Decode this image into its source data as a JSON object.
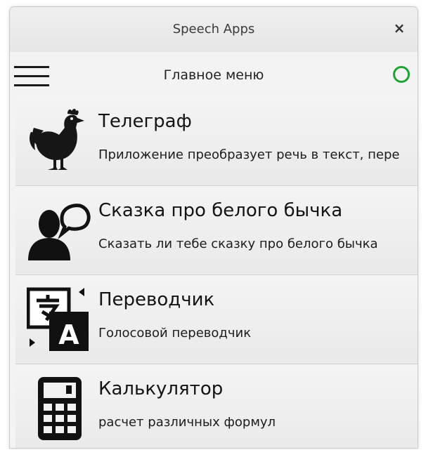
{
  "window": {
    "title": "Speech Apps",
    "close_label": "×"
  },
  "toolbar": {
    "title": "Главное меню",
    "menu_icon": "hamburger-menu-icon",
    "status_icon": "status-circle-icon",
    "status_color": "#22a232"
  },
  "apps": [
    {
      "title": "Телеграф",
      "subtitle": "Приложение преобразует речь в текст, пере",
      "icon": "chicken-icon"
    },
    {
      "title": "Сказка про белого бычка",
      "subtitle": "Сказать ли тебе сказку про белого бычка",
      "icon": "person-speech-icon"
    },
    {
      "title": "Переводчик",
      "subtitle": "Голосовой переводчик",
      "icon": "translate-icon"
    },
    {
      "title": "Калькулятор",
      "subtitle": "расчет различных формул",
      "icon": "calculator-icon"
    }
  ]
}
